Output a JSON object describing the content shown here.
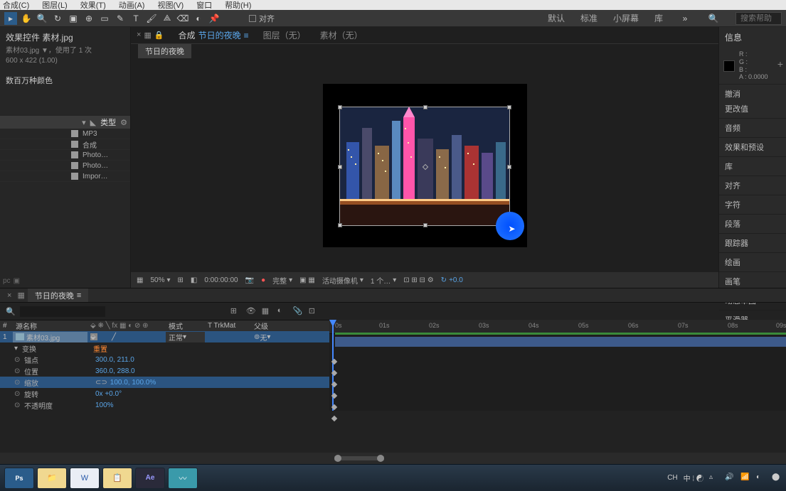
{
  "menu": {
    "composition": "合成(C)",
    "layer": "图层(L)",
    "effect": "效果(T)",
    "animation": "动画(A)",
    "view": "视图(V)",
    "window": "窗口",
    "help": "帮助(H)"
  },
  "toolbar": {
    "align_label": "对齐",
    "workspaces": {
      "default": "默认",
      "standard": "标准",
      "small_screen": "小屏幕",
      "library": "库"
    },
    "search_placeholder": "搜索帮助"
  },
  "effect_controls": {
    "title": "效果控件 素材.jpg",
    "info1": "素材03.jpg ▼，使用了 1 次",
    "info2": "600 x 422 (1.00)",
    "colors": "数百万种颜色"
  },
  "project": {
    "header": "类型",
    "types": [
      "MP3",
      "合成",
      "Photo…",
      "Photo…",
      "Impor…"
    ]
  },
  "viewer": {
    "tab_comp_prefix": "合成",
    "tab_comp_name": "节日的夜晚",
    "tab_layer": "图层（无）",
    "tab_footage": "素材（无）",
    "breadcrumb": "节日的夜晚"
  },
  "viewer_footer": {
    "zoom": "50%",
    "timecode": "0:00:00:00",
    "resolution": "完整",
    "camera": "活动摄像机",
    "views": "1 个…",
    "exposure": "+0.0"
  },
  "info_panel": {
    "title": "信息",
    "r": "R :",
    "g": "G :",
    "b": "B :",
    "a": "A :  0.0000",
    "items": [
      "撤消",
      "更改值",
      "音频",
      "效果和预设",
      "库",
      "对齐",
      "字符",
      "段落",
      "跟踪器",
      "绘画",
      "画笔",
      "动态草图",
      "平滑器"
    ]
  },
  "timeline": {
    "tab": "节日的夜晚",
    "cols": {
      "num": "#",
      "source": "源名称",
      "mode": "模式",
      "trkmat": "T  TrkMat",
      "parent": "父级"
    },
    "layer": {
      "num": "1",
      "name": "素材03.jpg",
      "mode": "正常",
      "parent": "无"
    },
    "transform": "变换",
    "transform_val": "重置",
    "props": [
      {
        "name": "锚点",
        "val": "300.0, 211.0"
      },
      {
        "name": "位置",
        "val": "360.0, 288.0"
      },
      {
        "name": "缩放",
        "val": "100.0, 100.0%"
      },
      {
        "name": "旋转",
        "val": "0x +0.0°"
      },
      {
        "name": "不透明度",
        "val": "100%"
      }
    ],
    "time_marks": [
      "0s",
      "01s",
      "02s",
      "03s",
      "04s",
      "05s",
      "06s",
      "07s",
      "08s",
      "09s"
    ]
  },
  "systray": {
    "ch": "CH",
    "ime": "中 ⁞ ☯"
  }
}
